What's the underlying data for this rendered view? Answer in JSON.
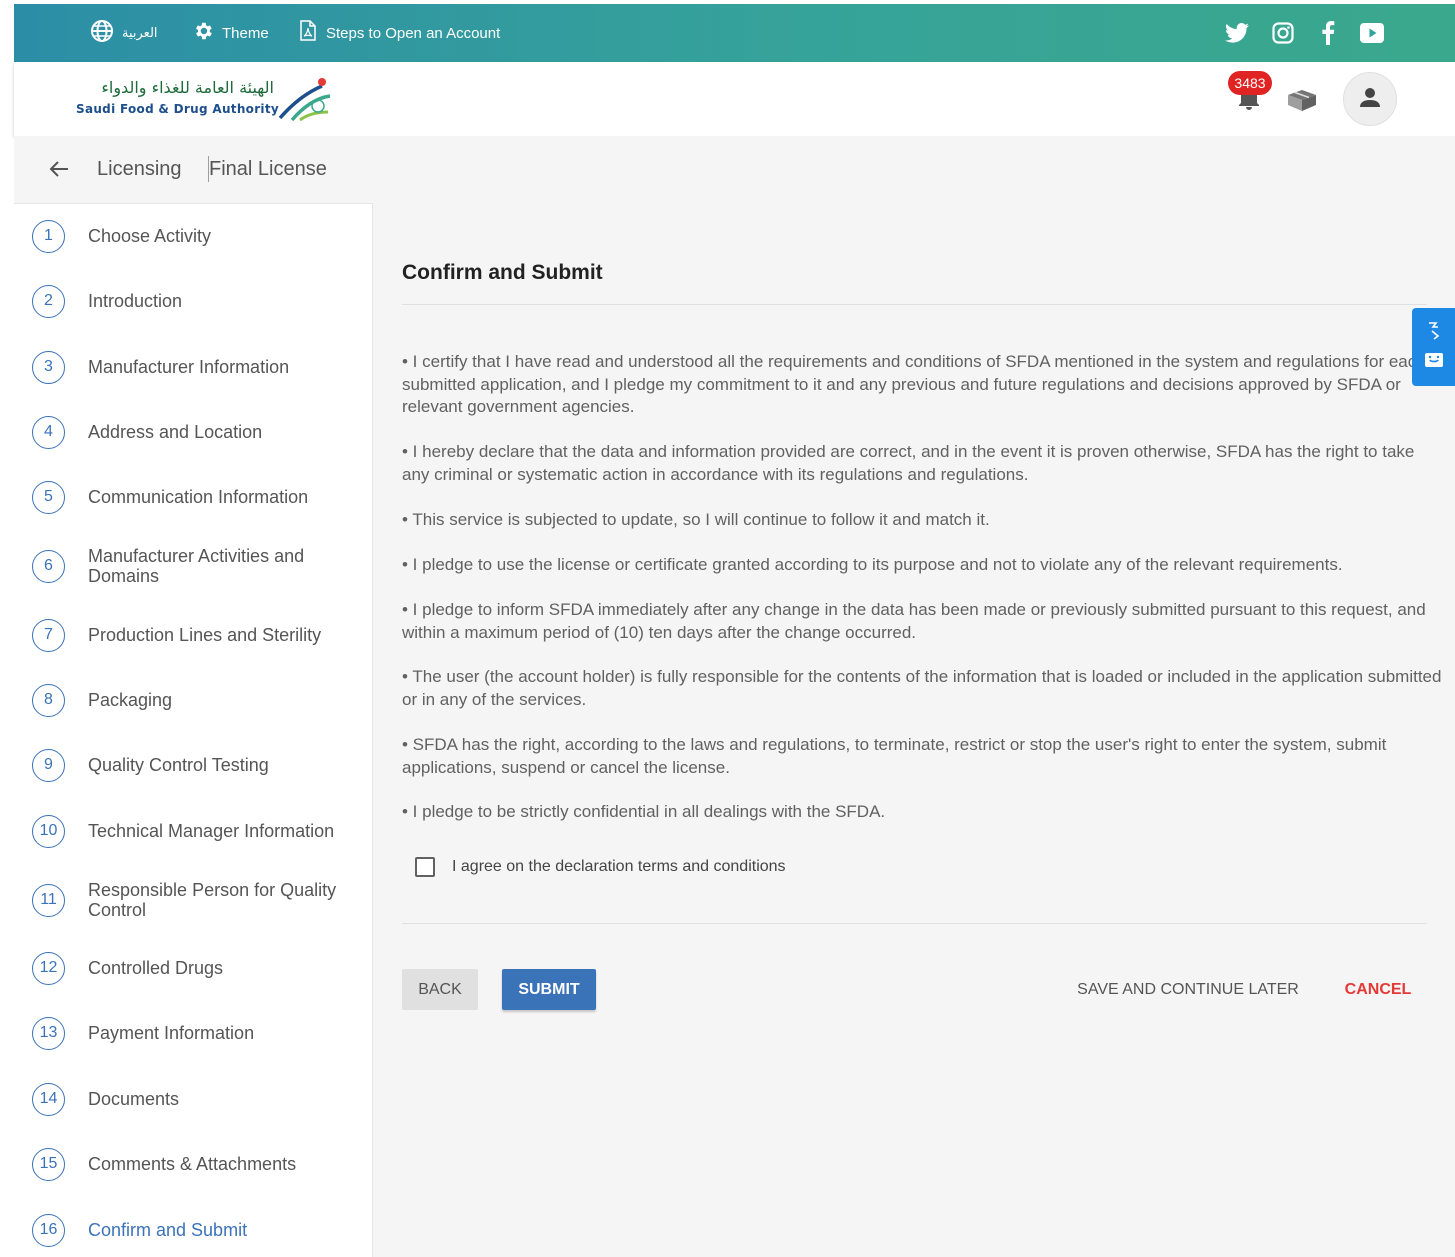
{
  "topbar": {
    "language_label": "العربية",
    "theme_label": "Theme",
    "steps_label": "Steps to Open an Account",
    "social_icons": [
      "twitter-icon",
      "instagram-icon",
      "facebook-icon",
      "youtube-icon"
    ]
  },
  "header": {
    "logo_arabic": "الهيئة العامة للغذاء والدواء",
    "logo_english": "Saudi Food & Drug Authority",
    "notification_count": "3483"
  },
  "breadcrumb": {
    "section": "Licensing",
    "page": "Final License"
  },
  "steps": [
    {
      "num": "1",
      "label": "Choose Activity"
    },
    {
      "num": "2",
      "label": "Introduction"
    },
    {
      "num": "3",
      "label": "Manufacturer Information"
    },
    {
      "num": "4",
      "label": "Address and Location"
    },
    {
      "num": "5",
      "label": "Communication Information"
    },
    {
      "num": "6",
      "label": "Manufacturer Activities and Domains"
    },
    {
      "num": "7",
      "label": "Production Lines and Sterility"
    },
    {
      "num": "8",
      "label": "Packaging"
    },
    {
      "num": "9",
      "label": "Quality Control Testing"
    },
    {
      "num": "10",
      "label": "Technical Manager Information"
    },
    {
      "num": "11",
      "label": "Responsible Person for Quality Control"
    },
    {
      "num": "12",
      "label": "Controlled Drugs"
    },
    {
      "num": "13",
      "label": "Payment Information"
    },
    {
      "num": "14",
      "label": "Documents"
    },
    {
      "num": "15",
      "label": "Comments & Attachments"
    },
    {
      "num": "16",
      "label": "Confirm and Submit"
    }
  ],
  "main": {
    "title": "Confirm and Submit",
    "declarations": [
      "• I certify that I have read and understood all the requirements and conditions of SFDA mentioned in the system and regulations for each submitted application, and I pledge my commitment to it and any previous and future regulations and decisions approved by SFDA or relevant government agencies.",
      "• I hereby declare that the data and information provided are correct, and in the event it is proven otherwise, SFDA has the right to take any criminal or systematic action in accordance with its regulations and regulations.",
      "• This service is subjected to update, so I will continue to follow it and match it.",
      "• I pledge to use the license or certificate granted according to its purpose and not to violate any of the relevant requirements.",
      "• I pledge to inform SFDA immediately after any change in the data has been made or previously submitted pursuant to this request, and within a maximum period of (10) ten days after the change occurred.",
      "• The user (the account holder) is fully responsible for the contents of the information that is loaded or included in the application submitted or in any of the services.",
      "• SFDA has the right, according to the laws and regulations, to terminate, restrict or stop the user's right to enter the system, submit applications, suspend or cancel the license.",
      "• I pledge to be strictly confidential in all dealings with the SFDA."
    ],
    "agree_label": "I agree on the declaration terms and conditions",
    "agree_checked": false,
    "back_label": "BACK",
    "submit_label": "SUBMIT",
    "save_label": "SAVE AND CONTINUE LATER",
    "cancel_label": "CANCEL"
  },
  "colors": {
    "primary": "#3b73b9",
    "topbar_start": "#2c8ea6",
    "topbar_end": "#3aa88c",
    "cancel": "#e53935",
    "badge": "#e02424"
  }
}
